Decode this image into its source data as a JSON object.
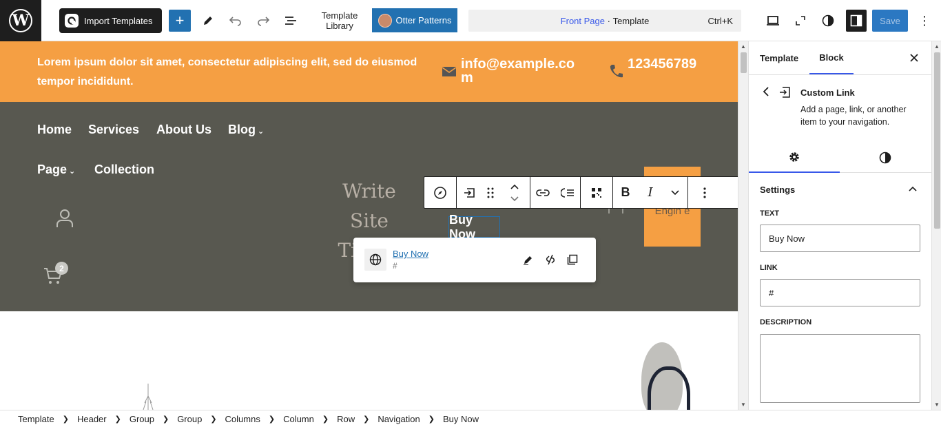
{
  "topbar": {
    "import_label": "Import Templates",
    "add_label": "+",
    "template_library_line1": "Template",
    "template_library_line2": "Library",
    "otter_label": "Otter Patterns",
    "command": {
      "page": "Front Page",
      "separator": " · ",
      "type": "Template",
      "shortcut": "Ctrl+K"
    },
    "save_label": "Save",
    "more_label": "⋮"
  },
  "site": {
    "topstrip_text": "Lorem ipsum dolor sit amet, consectetur adipiscing elit, sed do eiusmod tempor incididunt.",
    "email": "info@example.com",
    "phone": "123456789",
    "nav": [
      {
        "label": "Home",
        "has_submenu": false
      },
      {
        "label": "Services",
        "has_submenu": false
      },
      {
        "label": "About Us",
        "has_submenu": false
      },
      {
        "label": "Blog",
        "has_submenu": true
      },
      {
        "label": "Page",
        "has_submenu": true
      },
      {
        "label": "Collection",
        "has_submenu": false
      }
    ],
    "site_title": "Write Site Title...",
    "cart_count": "2",
    "buy_now": "Buy Now",
    "orange_box_text": "Engin e",
    "partial_letter": "r",
    "colors": {
      "accent_orange": "#f59f43",
      "header_bg": "#585850",
      "wp_blue": "#2271b1"
    }
  },
  "block_toolbar": {
    "buttons": [
      "compass-icon",
      "custom-link-icon",
      "drag-handle-icon",
      "move-up-down-icon",
      "link-icon",
      "add-submenu-icon",
      "qr-icon",
      "bold-icon",
      "italic-icon",
      "more-rich-text-icon",
      "options-icon"
    ],
    "bold_label": "B",
    "italic_label": "I"
  },
  "link_popover": {
    "title": "Buy Now",
    "url": "#"
  },
  "sidebar": {
    "tab_template": "Template",
    "tab_block": "Block",
    "block_title": "Custom Link",
    "block_description": "Add a page, link, or another item to your navigation.",
    "panel_title": "Settings",
    "fields": {
      "text_label": "TEXT",
      "text_value": "Buy Now",
      "link_label": "LINK",
      "link_value": "#",
      "description_label": "DESCRIPTION",
      "description_value": ""
    }
  },
  "breadcrumb": [
    "Template",
    "Header",
    "Group",
    "Group",
    "Columns",
    "Column",
    "Row",
    "Navigation",
    "Buy Now"
  ]
}
